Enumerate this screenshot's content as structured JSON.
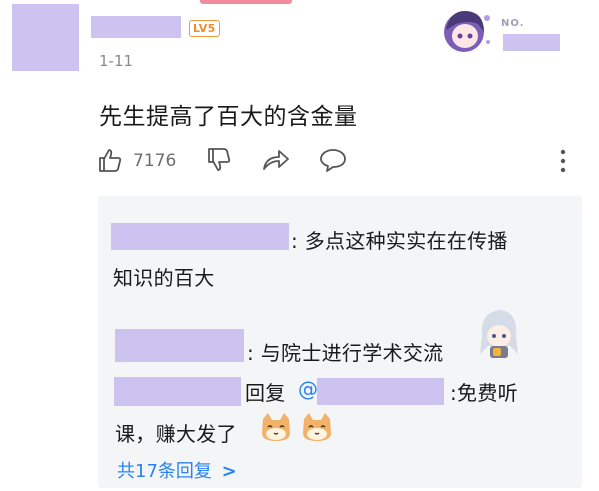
{
  "comment": {
    "level_badge": "LV5",
    "date": "1-11",
    "fan_label": "NO.",
    "text": "先生提高了百大的含金量",
    "like_count": "7176"
  },
  "replies": [
    {
      "sep": ":",
      "text_line1": "多点这种实实在在传播",
      "text_line2": "知识的百大"
    },
    {
      "sep": ":",
      "text": "与院士进行学术交流"
    },
    {
      "reply_word": "回复",
      "at": "@",
      "sep": ":",
      "text_line1": "免费听",
      "text_line2": "课，赚大发了"
    }
  ],
  "see_more": {
    "label": "共17条回复",
    "chevron": ">"
  },
  "icons": [
    "thumbs-up-icon",
    "thumbs-down-icon",
    "share-icon",
    "comment-icon",
    "more-vertical-icon"
  ],
  "colors": {
    "accent": "#2a83f2",
    "level": "#f28a2a",
    "redacted": "#cdc3f0",
    "reply_bg": "#f4f5f7"
  }
}
